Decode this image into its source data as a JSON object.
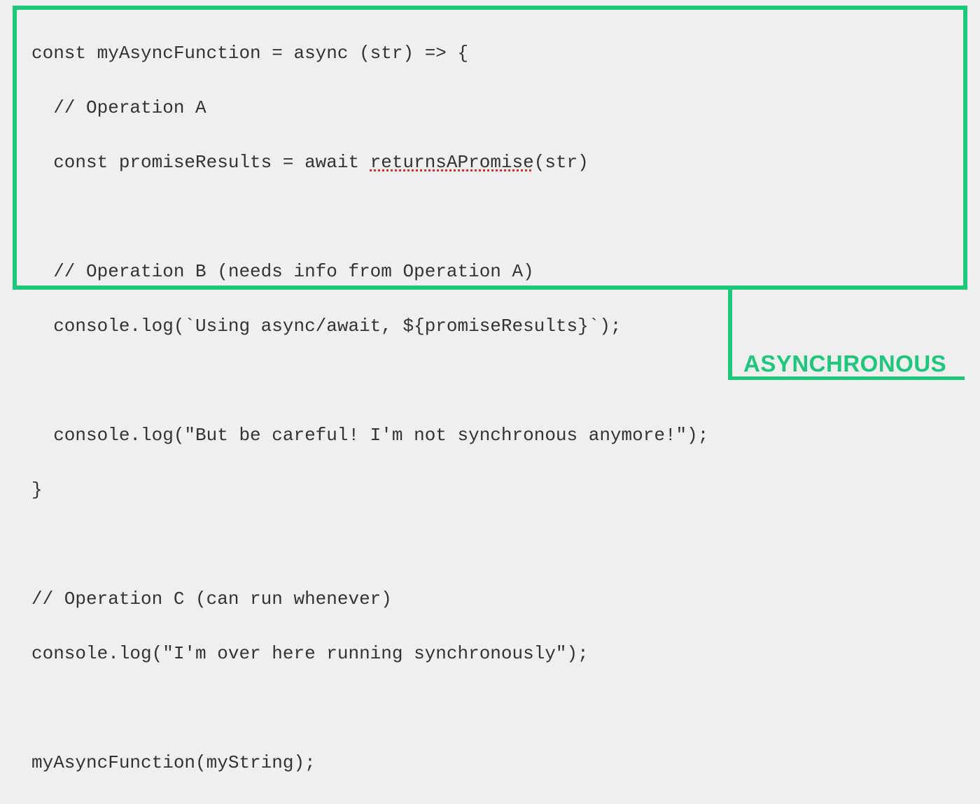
{
  "code": {
    "line1_part1": "const myAsyncFunction = async (str) => {",
    "line2": "  // Operation A",
    "line3_part1": "  const promiseResults = await ",
    "line3_spell": "returnsAPromise",
    "line3_part2": "(str)",
    "line5": "  // Operation B (needs info from Operation A)",
    "line6": "  console.log(`Using async/await, ${promiseResults}`);",
    "line8": "  console.log(\"But be careful! I'm not synchronous anymore!\");",
    "line9": "}",
    "line11": "// Operation C (can run whenever)",
    "line12": "console.log(\"I'm over here running synchronously\");",
    "line14": "myAsyncFunction(myString);"
  },
  "label": "ASYNCHRONOUS",
  "colors": {
    "highlight": "#1EC77A",
    "text": "#333333",
    "bg": "#efefef",
    "spellcheck": "#d93025"
  }
}
